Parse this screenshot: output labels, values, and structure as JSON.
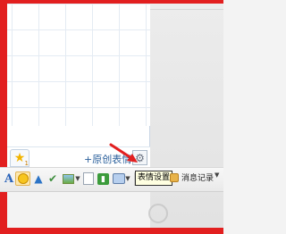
{
  "emoji_panel": {
    "favorites_badge": "1",
    "add_custom_label": "+原创表情",
    "settings_icon": "gear-icon"
  },
  "toolbar": {
    "font_label": "A",
    "icons": [
      "font-icon",
      "emoji-icon",
      "shake-icon",
      "check-icon",
      "image-icon",
      "document-icon",
      "green-app-icon",
      "screenshot-icon"
    ]
  },
  "tooltip": {
    "text": "表情设置"
  },
  "message_history": {
    "label": "消息记录"
  },
  "colors": {
    "annotation_red": "#e21f1f",
    "tooltip_bg": "#ffffe1",
    "link_blue": "#2a5f9b"
  }
}
